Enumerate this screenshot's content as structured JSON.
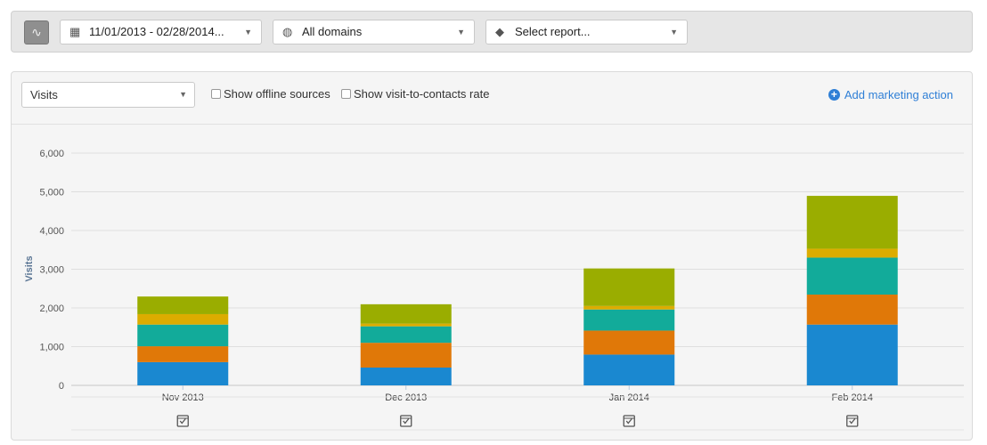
{
  "toolbar": {
    "activity_icon": "pulse-icon",
    "date_range": "11/01/2013 - 02/28/2014...",
    "domains": "All domains",
    "report": "Select report..."
  },
  "panel": {
    "metric": "Visits",
    "offline_label": "Show offline sources",
    "rate_label": "Show visit-to-contacts rate",
    "add_action": "Add marketing action"
  },
  "chart_data": {
    "type": "bar",
    "stacked": true,
    "categories": [
      "Nov 2013",
      "Dec 2013",
      "Jan 2014",
      "Feb 2014"
    ],
    "ylabel": "Visits",
    "ylim": [
      0,
      6000
    ],
    "yticks": [
      "0",
      "1,000",
      "2,000",
      "3,000",
      "4,000",
      "5,000",
      "6,000"
    ],
    "grid": true,
    "series": [
      {
        "color": "#1a88d0",
        "values": [
          600,
          460,
          795,
          1570
        ]
      },
      {
        "color": "#e07808",
        "values": [
          410,
          640,
          620,
          775
        ]
      },
      {
        "color": "#12ab9a",
        "values": [
          560,
          425,
          545,
          955
        ]
      },
      {
        "color": "#dcac00",
        "values": [
          270,
          70,
          90,
          230
        ]
      },
      {
        "color": "#9aad00",
        "values": [
          455,
          500,
          970,
          1365
        ]
      }
    ],
    "marker_icon": "calendar-check-icon"
  }
}
